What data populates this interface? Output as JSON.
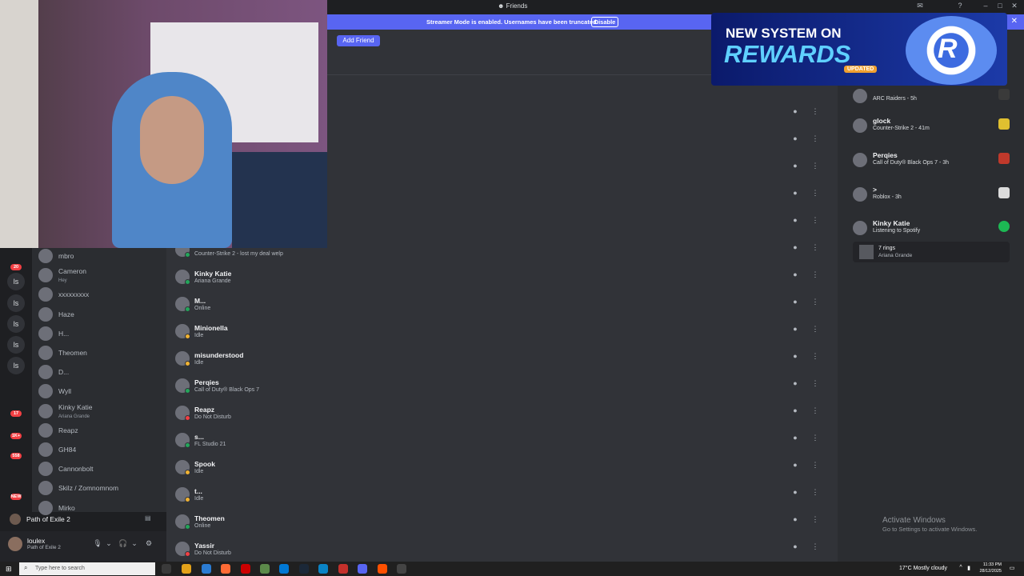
{
  "window": {
    "title": "Friends"
  },
  "banner": {
    "message": "Streamer Mode is enabled. Usernames have been truncated.",
    "disable_label": "Disable"
  },
  "toolbar": {
    "add_friend_label": "Add Friend"
  },
  "friends": [
    {
      "name": "",
      "status": ""
    },
    {
      "name": "",
      "status": ""
    },
    {
      "name": "",
      "status": ""
    },
    {
      "name": "",
      "status": ""
    },
    {
      "name": "",
      "status": ""
    },
    {
      "name": "",
      "status": "Counter-Strike 2 - lost my deal welp"
    },
    {
      "name": "Kinky Katie",
      "status": "Ariana Grande"
    },
    {
      "name": "M...",
      "status": "Online"
    },
    {
      "name": "Minionella",
      "status": "Idle"
    },
    {
      "name": "misunderstood",
      "status": "Idle"
    },
    {
      "name": "Perqies",
      "status": "Call of Duty® Black Ops 7"
    },
    {
      "name": "Reapz",
      "status": "Do Not Disturb"
    },
    {
      "name": "s...",
      "status": "FL Studio 21"
    },
    {
      "name": "Spook",
      "status": "Idle"
    },
    {
      "name": "t...",
      "status": "Idle"
    },
    {
      "name": "Theomen",
      "status": "Online"
    },
    {
      "name": "Yassir",
      "status": "Do Not Disturb"
    }
  ],
  "activity": [
    {
      "name": "",
      "sub": "ARC Raiders - 5h"
    },
    {
      "name": "glock",
      "sub": "Counter-Strike 2 - 41m"
    },
    {
      "name": "Perqies",
      "sub": "Call of Duty® Black Ops 7 - 3h"
    },
    {
      "name": ">",
      "sub": "Roblox - 3h"
    },
    {
      "name": "Kinky Katie",
      "sub": "Listening to Spotify"
    }
  ],
  "track": {
    "title": "7 rings",
    "artist": "Ariana Grande"
  },
  "ad": {
    "line1": "NEW SYSTEM ON",
    "line2": "REWARDS",
    "tag": "UPDATED",
    "logo": "R"
  },
  "servers": {
    "labels": [
      "ls",
      "ls",
      "ls",
      "ls",
      "ls"
    ],
    "badges": [
      "20",
      "17",
      "1K+",
      "558",
      "NEW"
    ]
  },
  "dms": [
    {
      "name": "mbro",
      "sub": ""
    },
    {
      "name": "Cameron",
      "sub": "Hey"
    },
    {
      "name": "xxxxxxxxx",
      "sub": ""
    },
    {
      "name": "Haze",
      "sub": ""
    },
    {
      "name": "H...",
      "sub": ""
    },
    {
      "name": "Theomen",
      "sub": ""
    },
    {
      "name": "D...",
      "sub": ""
    },
    {
      "name": "Wyll",
      "sub": ""
    },
    {
      "name": "Kinky Katie",
      "sub": "Ariana Grande"
    },
    {
      "name": "Reapz",
      "sub": ""
    },
    {
      "name": "GH84",
      "sub": ""
    },
    {
      "name": "Cannonbolt",
      "sub": ""
    },
    {
      "name": "Skilz / Zomnomnom",
      "sub": ""
    },
    {
      "name": "Mirko",
      "sub": ""
    }
  ],
  "voice": {
    "channel": "Path of Exile 2"
  },
  "user": {
    "name": "loulex",
    "sub": "Path of Exile 2"
  },
  "watermark": {
    "line1": "Activate Windows",
    "line2": "Go to Settings to activate Windows."
  },
  "taskbar": {
    "search_placeholder": "Type here to search",
    "weather": "17°C  Mostly cloudy",
    "time": "11:33 PM",
    "date": "28/12/2025"
  },
  "colors": {
    "accent": "#5865f2",
    "online": "#23a55a",
    "idle": "#f0b232",
    "dnd": "#f23f43",
    "spotify": "#1db954"
  },
  "icons": [
    "friends-icon",
    "message-icon",
    "more-icon",
    "mic-icon",
    "headphones-icon",
    "settings-icon",
    "windows-start-icon",
    "search-icon",
    "spotify-icon"
  ]
}
